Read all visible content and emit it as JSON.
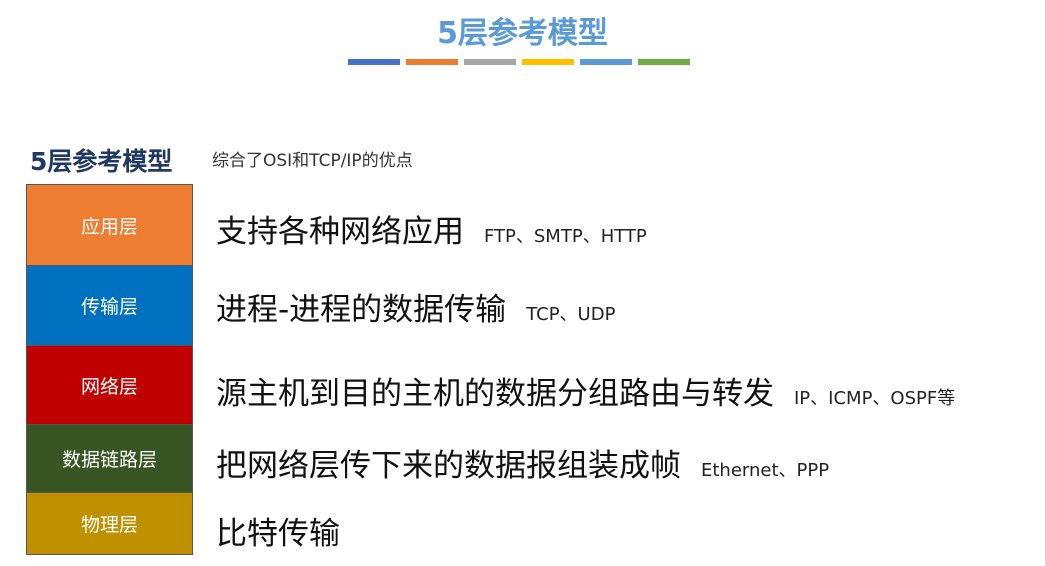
{
  "title": "5层参考模型",
  "title_bar_colors": [
    "#4472c4",
    "#ed7d31",
    "#a5a5a5",
    "#ffc000",
    "#5b9bd5",
    "#70ad47"
  ],
  "subtitle": {
    "heading": "5层参考模型",
    "note": "综合了OSI和TCP/IP的优点"
  },
  "layers": [
    {
      "name": "应用层",
      "color": "#ed7d31",
      "function": "支持各种网络应用",
      "protocols": "FTP、SMTP、HTTP"
    },
    {
      "name": "传输层",
      "color": "#0070c0",
      "function": "进程-进程的数据传输",
      "protocols": "TCP、UDP"
    },
    {
      "name": "网络层",
      "color": "#c00000",
      "function": "源主机到目的主机的数据分组路由与转发",
      "protocols": "IP、ICMP、OSPF等"
    },
    {
      "name": "数据链路层",
      "color": "#375623",
      "function": "把网络层传下来的数据报组装成帧",
      "protocols": "Ethernet、PPP"
    },
    {
      "name": "物理层",
      "color": "#bf9000",
      "function": "比特传输",
      "protocols": ""
    }
  ]
}
